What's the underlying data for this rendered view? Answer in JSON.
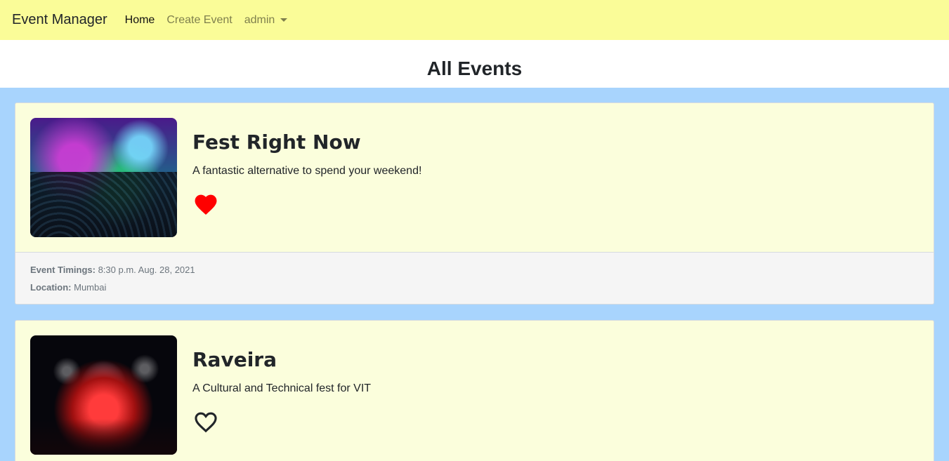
{
  "nav": {
    "brand": "Event Manager",
    "links": [
      {
        "label": "Home",
        "active": true
      },
      {
        "label": "Create Event",
        "active": false
      }
    ],
    "user_dropdown": "admin"
  },
  "page": {
    "title": "All Events"
  },
  "events": [
    {
      "name": "Fest Right Now",
      "description": "A fantastic alternative to spend your weekend!",
      "liked": true,
      "heart_icon": "heart-filled-icon",
      "timings_label": "Event Timings:",
      "timings": "8:30 p.m. Aug. 28, 2021",
      "location_label": "Location:",
      "location": "Mumbai"
    },
    {
      "name": "Raveira",
      "description": "A Cultural and Technical fest for VIT",
      "liked": false,
      "heart_icon": "heart-outline-icon"
    }
  ],
  "colors": {
    "navbar_bg": "#fafc98",
    "page_bg": "#a8d4fd",
    "card_bg": "#fbfedc",
    "heart_liked": "#ff0000"
  }
}
